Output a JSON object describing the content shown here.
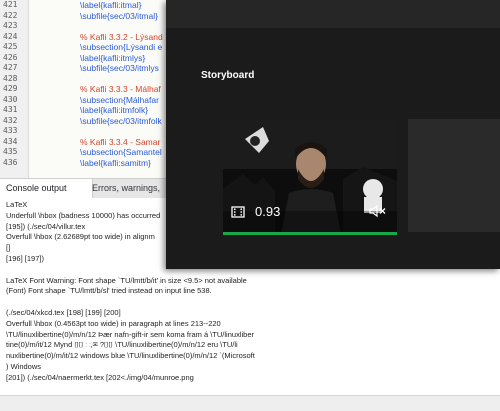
{
  "editor": {
    "lines": [
      {
        "n": "421",
        "text": "\\label{kafli:itmal}",
        "cls": "kw"
      },
      {
        "n": "422",
        "text": "\\subfile{sec/03/itmal}",
        "cls": "kw"
      },
      {
        "n": "423",
        "text": "",
        "cls": "tx"
      },
      {
        "n": "424",
        "text": "% Kafli 3.3.2 - Lýsand",
        "cls": "cm"
      },
      {
        "n": "425",
        "text": "\\subsection{Lýsandi e",
        "cls": "kw"
      },
      {
        "n": "426",
        "text": "\\label{kafli:itmlys}",
        "cls": "kw"
      },
      {
        "n": "427",
        "text": "\\subfile{sec/03/itmlys",
        "cls": "kw"
      },
      {
        "n": "428",
        "text": "",
        "cls": "tx"
      },
      {
        "n": "429",
        "text": "% Kafli 3.3.3 - Málhaf",
        "cls": "cm"
      },
      {
        "n": "430",
        "text": "\\subsection{Málhafar",
        "cls": "kw"
      },
      {
        "n": "431",
        "text": "\\label{kafli:itmfolk}",
        "cls": "kw"
      },
      {
        "n": "432",
        "text": "\\subfile{sec/03/itmfolk",
        "cls": "kw"
      },
      {
        "n": "433",
        "text": "",
        "cls": "tx"
      },
      {
        "n": "434",
        "text": "% Kafli 3.3.4 - Samar",
        "cls": "cm"
      },
      {
        "n": "435",
        "text": "\\subsection{Samantel",
        "cls": "kw"
      },
      {
        "n": "436",
        "text": "\\label{kafli:samitm}",
        "cls": "kw"
      }
    ]
  },
  "tabs": {
    "console": "Console output",
    "errors": "Errors, warnings,"
  },
  "console": {
    "lines": [
      "LaTeX",
      "Underfull \\hbox (badness 10000) has occurred",
      "[195]) (./sec/04/villur.tex",
      "Overfull \\hbox (2.62689pt too wide) in alignm",
      "[]",
      "[196] [197])",
      "",
      "LaTeX Font Warning: Font shape `TU/lmtt/b/it' in size <9.5> not available",
      "(Font)              Font shape `TU/lmtt/b/sl' tried instead on input line 538.",
      "",
      "(./sec/04/xkcd.tex [198] [199] [200]",
      "Overfull \\hbox (0.4563pt too wide) in paragraph at lines 213--220",
      "\\TU/linuxlibertine(0)/m/n/12 Þær nafn-gift-ir sem koma fram á \\TU/linuxliber",
      "tine(0)/m/it/12 Mynd ⌷⌷ ⸬,✉ ?⌷⌷ \\TU/linuxlibertine(0)/m/n/12 eru \\TU/li",
      "nuxlibertine(0)/m/it/12 windows blue \\TU/linuxlibertine(0)/m/n/12 `(Microsoft",
      ") Windows",
      "[201]) (./sec/04/naermerkt.tex [202<./img/04/munroe.png"
    ]
  },
  "storyboard": {
    "title": "Storyboard",
    "clip": {
      "duration": "0.93",
      "progress": 1.0,
      "accent": "#17a84a"
    }
  }
}
